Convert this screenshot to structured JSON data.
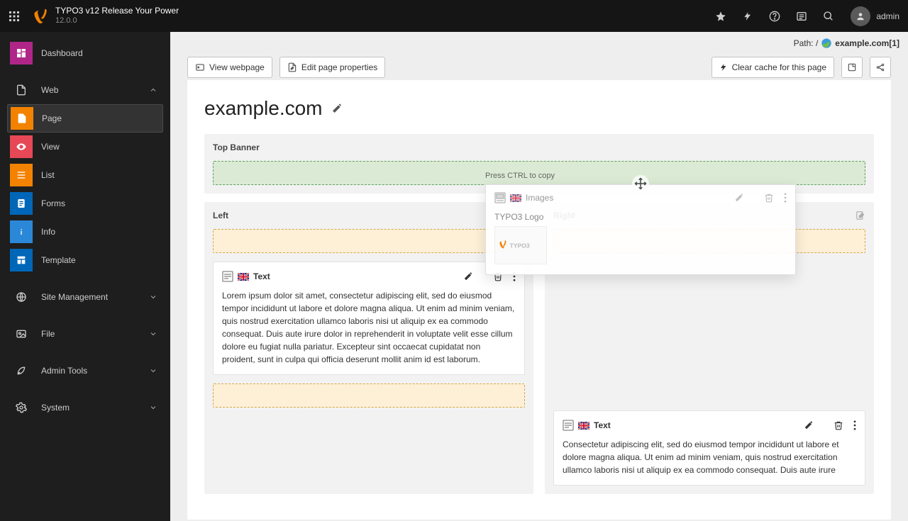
{
  "brand": {
    "title": "TYPO3 v12 Release Your Power",
    "version": "12.0.0"
  },
  "user": {
    "name": "admin"
  },
  "sidebar": {
    "dashboard": "Dashboard",
    "web": "Web",
    "web_items": [
      {
        "label": "Page",
        "color": "#f38200"
      },
      {
        "label": "View",
        "color": "#e74856"
      },
      {
        "label": "List",
        "color": "#f38200"
      },
      {
        "label": "Forms",
        "color": "#0067b8"
      },
      {
        "label": "Info",
        "color": "#2b88d8"
      },
      {
        "label": "Template",
        "color": "#0067b8"
      }
    ],
    "groups": [
      "Site Management",
      "File",
      "Admin Tools",
      "System"
    ]
  },
  "path": {
    "prefix": "Path: / ",
    "page": "example.com",
    "suffix": " [1]"
  },
  "toolbar": {
    "view_webpage": "View webpage",
    "edit_props": "Edit page properties",
    "clear_cache": "Clear cache for this page"
  },
  "page": {
    "title": "example.com",
    "columns": {
      "top_banner": "Top Banner",
      "left": "Left",
      "right": "Right"
    }
  },
  "content_left": {
    "type_label": "Text",
    "body": "Lorem ipsum dolor sit amet, consectetur adipiscing elit, sed do eiusmod tempor incididunt ut labore et dolore magna aliqua. Ut enim ad minim veniam, quis nostrud exercitation ullamco laboris nisi ut aliquip ex ea commodo consequat. Duis aute irure dolor in reprehenderit in voluptate velit esse cillum dolore eu fugiat nulla pariatur. Excepteur sint occaecat cupidatat non proident, sunt in culpa qui officia deserunt mollit anim id est laborum."
  },
  "content_right": {
    "type_label": "Text",
    "body": "Consectetur adipiscing elit, sed do eiusmod tempor incididunt ut labore et dolore magna aliqua. Ut enim ad minim veniam, quis nostrud exercitation ullamco laboris nisi ut aliquip ex ea commodo consequat. Duis aute irure"
  },
  "drag": {
    "hint": "Press CTRL to copy",
    "type_label": "Images",
    "caption": "TYPO3 Logo"
  }
}
